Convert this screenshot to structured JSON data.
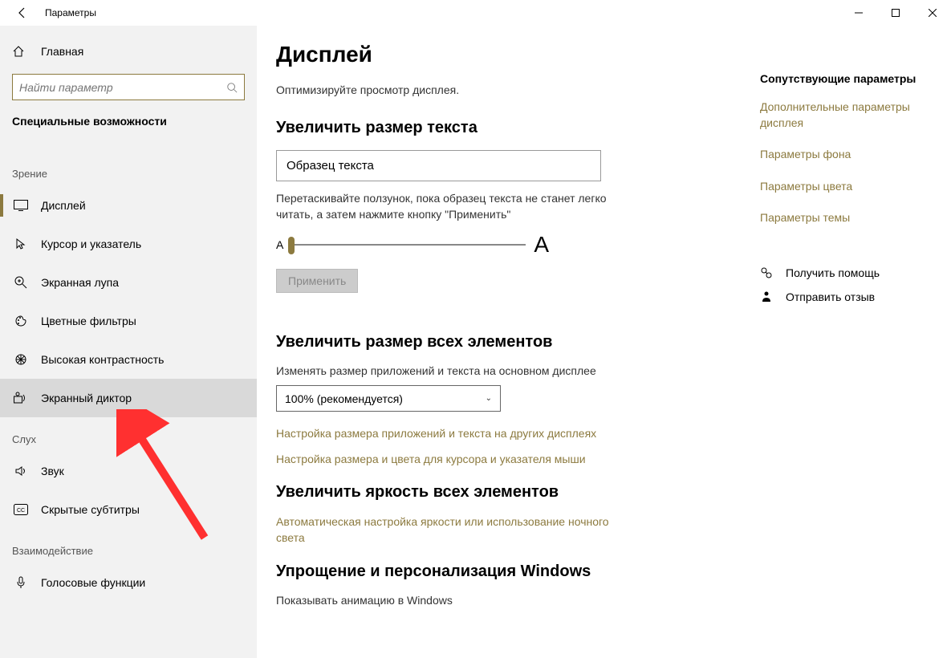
{
  "titlebar": {
    "title": "Параметры"
  },
  "sidebar": {
    "home": "Главная",
    "search_placeholder": "Найти параметр",
    "category": "Специальные возможности",
    "group_vision": "Зрение",
    "group_hearing": "Слух",
    "group_interaction": "Взаимодействие",
    "items_vision": [
      {
        "label": "Дисплей",
        "icon": "monitor"
      },
      {
        "label": "Курсор и указатель",
        "icon": "cursor"
      },
      {
        "label": "Экранная лупа",
        "icon": "magnify"
      },
      {
        "label": "Цветные фильтры",
        "icon": "palette"
      },
      {
        "label": "Высокая контрастность",
        "icon": "contrast"
      },
      {
        "label": "Экранный диктор",
        "icon": "narrator"
      }
    ],
    "items_hearing": [
      {
        "label": "Звук",
        "icon": "sound"
      },
      {
        "label": "Скрытые субтитры",
        "icon": "cc"
      }
    ],
    "items_interaction": [
      {
        "label": "Голосовые функции",
        "icon": "mic"
      }
    ]
  },
  "main": {
    "title": "Дисплей",
    "optimize": "Оптимизируйте просмотр дисплея.",
    "h_textsize": "Увеличить размер текста",
    "sample": "Образец текста",
    "slider_instr": "Перетаскивайте ползунок, пока образец текста не станет легко читать, а затем нажмите кнопку \"Применить\"",
    "apply": "Применить",
    "h_allsize": "Увеличить размер всех элементов",
    "scale_label": "Изменять размер приложений и текста на основном дисплее",
    "scale_value": "100% (рекомендуется)",
    "link_other_displays": "Настройка размера приложений и текста на других дисплеях",
    "link_cursor": "Настройка размера и цвета для курсора и указателя мыши",
    "h_brightness": "Увеличить яркость всех элементов",
    "link_nightlight": "Автоматическая настройка яркости или использование ночного света",
    "h_simplify": "Упрощение и персонализация Windows",
    "show_anim": "Показывать анимацию в Windows"
  },
  "rightcol": {
    "title": "Сопутствующие параметры",
    "links": [
      "Дополнительные параметры дисплея",
      "Параметры фона",
      "Параметры цвета",
      "Параметры темы"
    ],
    "help": "Получить помощь",
    "feedback": "Отправить отзыв"
  }
}
